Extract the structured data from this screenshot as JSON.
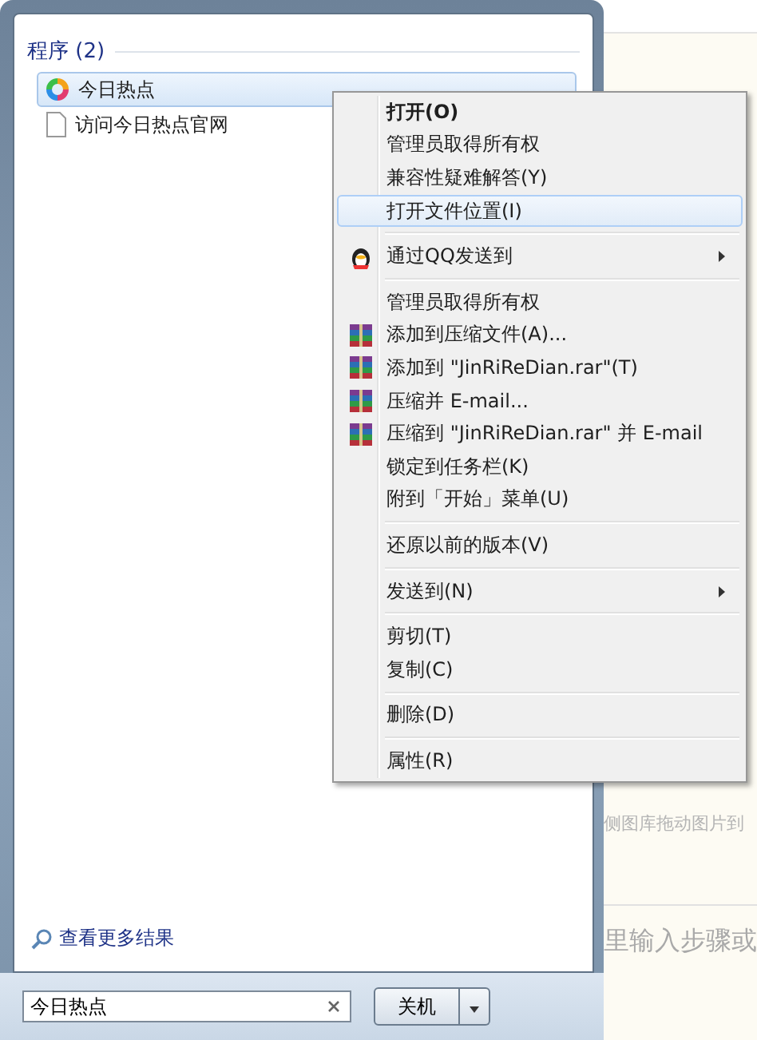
{
  "start_menu": {
    "group_header": "程序 (2)",
    "programs": [
      {
        "kind": "app",
        "label": "今日热点",
        "selected": true
      },
      {
        "kind": "file",
        "label": "访问今日热点官网",
        "selected": false
      }
    ],
    "see_more": "查看更多结果",
    "search": {
      "value": "今日热点"
    },
    "shutdown": {
      "label": "关机"
    }
  },
  "background_page": {
    "texts": [
      "侧图库拖动图片到",
      "里输入步骤或"
    ]
  },
  "context_menu": {
    "items": [
      {
        "kind": "item",
        "label": "打开(O)",
        "default": true,
        "selected": false
      },
      {
        "kind": "item",
        "label": "管理员取得所有权",
        "default": false,
        "selected": false
      },
      {
        "kind": "item",
        "label": "兼容性疑难解答(Y)",
        "default": false,
        "selected": false
      },
      {
        "kind": "item",
        "label": "打开文件位置(I)",
        "default": false,
        "selected": true
      },
      {
        "kind": "separator"
      },
      {
        "kind": "share",
        "label": "通过QQ发送到",
        "submenu": true,
        "default": false,
        "selected": false
      },
      {
        "kind": "separator"
      },
      {
        "kind": "item",
        "label": "管理员取得所有权",
        "default": false,
        "selected": false
      },
      {
        "kind": "archive",
        "label": "添加到压缩文件(A)...",
        "default": false,
        "selected": false
      },
      {
        "kind": "archive",
        "label": "添加到 \"JinRiReDian.rar\"(T)",
        "default": false,
        "selected": false
      },
      {
        "kind": "archive",
        "label": "压缩并 E-mail...",
        "default": false,
        "selected": false
      },
      {
        "kind": "archive",
        "label": "压缩到 \"JinRiReDian.rar\" 并 E-mail",
        "default": false,
        "selected": false
      },
      {
        "kind": "item",
        "label": "锁定到任务栏(K)",
        "default": false,
        "selected": false
      },
      {
        "kind": "item",
        "label": "附到「开始」菜单(U)",
        "default": false,
        "selected": false
      },
      {
        "kind": "separator"
      },
      {
        "kind": "item",
        "label": "还原以前的版本(V)",
        "default": false,
        "selected": false
      },
      {
        "kind": "separator"
      },
      {
        "kind": "item",
        "label": "发送到(N)",
        "submenu": true,
        "default": false,
        "selected": false
      },
      {
        "kind": "separator"
      },
      {
        "kind": "item",
        "label": "剪切(T)",
        "default": false,
        "selected": false
      },
      {
        "kind": "item",
        "label": "复制(C)",
        "default": false,
        "selected": false
      },
      {
        "kind": "separator"
      },
      {
        "kind": "item",
        "label": "删除(D)",
        "default": false,
        "selected": false
      },
      {
        "kind": "separator"
      },
      {
        "kind": "item",
        "label": "属性(R)",
        "default": false,
        "selected": false
      }
    ]
  }
}
